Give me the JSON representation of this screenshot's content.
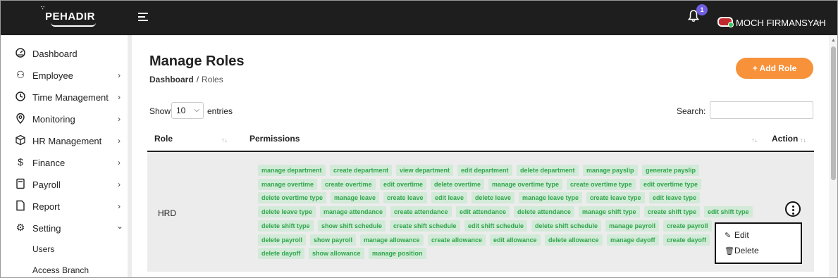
{
  "header": {
    "logo_text": "EHADIR",
    "logo_prefix": "P",
    "notification_count": "1",
    "user_name": "MOCH FIRMANSYAH"
  },
  "sidebar": {
    "items": [
      {
        "label": "Dashboard",
        "icon": "dashboard-gauge-icon"
      },
      {
        "label": "Employee",
        "icon": "users-icon",
        "chevron": "›"
      },
      {
        "label": "Time Management",
        "icon": "clock-icon",
        "chevron": "›"
      },
      {
        "label": "Monitoring",
        "icon": "location-pin-icon",
        "chevron": "›"
      },
      {
        "label": "HR Management",
        "icon": "cube-icon",
        "chevron": "›"
      },
      {
        "label": "Finance",
        "icon": "dollar-icon",
        "chevron": "›"
      },
      {
        "label": "Payroll",
        "icon": "calculator-icon",
        "chevron": "›"
      },
      {
        "label": "Report",
        "icon": "file-icon",
        "chevron": "›"
      },
      {
        "label": "Setting",
        "icon": "gear-icon",
        "chevron": "⌄"
      }
    ],
    "sub_items": [
      "Users",
      "Access Branch"
    ]
  },
  "main": {
    "title": "Manage Roles",
    "breadcrumb": {
      "home": "Dashboard",
      "separator": "/",
      "current": "Roles"
    },
    "add_button": "+ Add Role",
    "show_label": "Show",
    "entries_value": "10",
    "entries_label": "entries",
    "search_label": "Search:",
    "search_value": ""
  },
  "table": {
    "headers": {
      "role": "Role",
      "permissions": "Permissions",
      "action": "Action"
    },
    "rows": [
      {
        "role": "HRD",
        "permissions": [
          [
            "manage department",
            "create department",
            "view department",
            "edit department",
            "delete department",
            "manage payslip",
            "generate payslip"
          ],
          [
            "manage overtime",
            "create overtime",
            "edit overtime",
            "delete overtime",
            "manage overtime type",
            "create overtime type",
            "edit overtime type"
          ],
          [
            "delete overtime type",
            "manage leave",
            "create leave",
            "edit leave",
            "delete leave",
            "manage leave type",
            "create leave type",
            "edit leave type"
          ],
          [
            "delete leave type",
            "manage attendance",
            "create attendance",
            "edit attendance",
            "delete attendance",
            "manage shift type",
            "create shift type",
            "edit shift type"
          ],
          [
            "delete shift type",
            "show shift schedule",
            "create shift schedule",
            "edit shift schedule",
            "delete shift schedule",
            "manage payroll",
            "create payroll"
          ],
          [
            "delete payroll",
            "show payroll",
            "manage allowance",
            "create allowance",
            "edit allowance",
            "delete allowance",
            "manage dayoff",
            "create dayoff"
          ],
          [
            "delete dayoff",
            "show allowance",
            "manage position"
          ]
        ]
      }
    ],
    "action_menu": {
      "edit": "Edit",
      "delete": "Delete"
    }
  },
  "colors": {
    "topbar": "#1e1e1e",
    "accent": "#f7923a",
    "tag_bg": "#d2ead8",
    "tag_text": "#2fa64a",
    "badge": "#6f5fe0"
  }
}
